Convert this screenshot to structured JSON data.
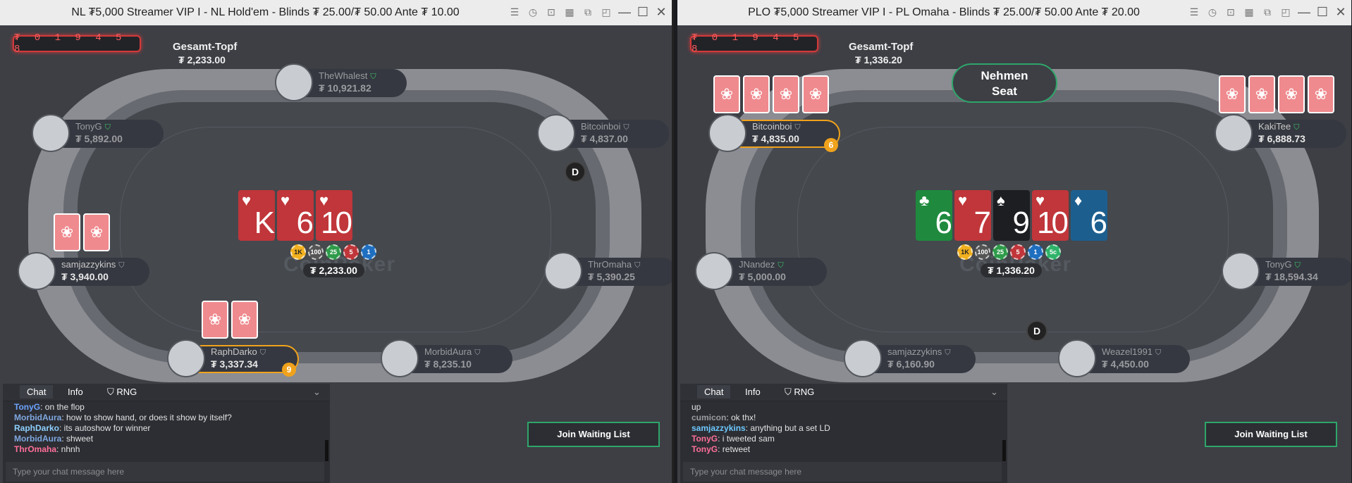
{
  "left": {
    "title": "NL ₮5,000 Streamer VIP I - NL Hold'em - Blinds ₮ 25.00/₮ 50.00 Ante ₮ 10.00",
    "ticker": "₮ 0 1 9  4 5 8",
    "pot_label": "Gesamt-Topf",
    "pot_total": "₮ 2,233.00",
    "center_pot": "₮ 2,233.00",
    "logo": "CoinPoker",
    "dealer": "D",
    "seats": [
      {
        "name": "TheWhalest",
        "stack": "₮ 10,921.82"
      },
      {
        "name": "TonyG",
        "stack": "₮ 5,892.00"
      },
      {
        "name": "Bitcoinboi",
        "stack": "₮ 4,837.00"
      },
      {
        "name": "samjazzykins",
        "stack": "₮ 3,940.00"
      },
      {
        "name": "ThrOmaha",
        "stack": "₮ 5,390.25"
      },
      {
        "name": "RaphDarko",
        "stack": "₮ 3,337.34",
        "seat_no": "9"
      },
      {
        "name": "MorbidAura",
        "stack": "₮ 8,235.10"
      }
    ],
    "board": [
      {
        "suit": "♥",
        "rank": "K",
        "color": "#c0363a"
      },
      {
        "suit": "♥",
        "rank": "6",
        "color": "#c0363a"
      },
      {
        "suit": "♥",
        "rank": "10",
        "color": "#c0363a"
      }
    ],
    "chips": [
      "1K",
      "100",
      "25",
      "5",
      "1"
    ],
    "chat": {
      "tabs": [
        "Chat",
        "Info",
        "RNG"
      ],
      "messages": [
        {
          "user": "TonyG",
          "text": ": on the flop",
          "color": "#6ea4ff"
        },
        {
          "user": "MorbidAura",
          "text": ": how to show hand, or does it show by itself?",
          "color": "#7fa7e0"
        },
        {
          "user": "RaphDarko",
          "text": ": its autoshow for winner",
          "color": "#8fd0ff"
        },
        {
          "user": "MorbidAura",
          "text": ": shweet",
          "color": "#7fa7e0"
        },
        {
          "user": "ThrOmaha",
          "text": ": nhnh",
          "color": "#ff6f9a"
        }
      ],
      "placeholder": "Type your chat message here"
    },
    "waitlist": "Join Waiting List"
  },
  "right": {
    "title": "PLO ₮5,000 Streamer VIP I - PL Omaha - Blinds ₮ 25.00/₮ 50.00 Ante ₮ 20.00",
    "ticker": "₮ 0 1 9  4 5 8",
    "pot_label": "Gesamt-Topf",
    "pot_total": "₮ 1,336.20",
    "center_pot": "₮ 1,336.20",
    "logo": "CoinPoker",
    "dealer": "D",
    "take_seat": [
      "Nehmen",
      "Seat"
    ],
    "seats": [
      {
        "name": "Bitcoinboi",
        "stack": "₮ 4,835.00",
        "seat_no": "6"
      },
      {
        "name": "KakiTee",
        "stack": "₮ 6,888.73"
      },
      {
        "name": "JNandez",
        "stack": "₮ 5,000.00"
      },
      {
        "name": "TonyG",
        "stack": "₮ 18,594.34"
      },
      {
        "name": "samjazzykins",
        "stack": "₮ 6,160.90"
      },
      {
        "name": "Weazel1991",
        "stack": "₮ 4,450.00"
      }
    ],
    "board": [
      {
        "suit": "♣",
        "rank": "6",
        "color": "#1f8a3e"
      },
      {
        "suit": "♥",
        "rank": "7",
        "color": "#c0363a"
      },
      {
        "suit": "♠",
        "rank": "9",
        "color": "#1d1e22"
      },
      {
        "suit": "♥",
        "rank": "10",
        "color": "#c0363a"
      },
      {
        "suit": "♦",
        "rank": "6",
        "color": "#1c5f8f"
      }
    ],
    "chips": [
      "1K",
      "100",
      "25",
      "5",
      "1",
      "5c"
    ],
    "chat": {
      "tabs": [
        "Chat",
        "Info",
        "RNG"
      ],
      "messages": [
        {
          "user": "",
          "text": "up",
          "color": "#e2e2e2"
        },
        {
          "user": "cumicon",
          "text": ": ok thx!",
          "color": "#9a9ca0"
        },
        {
          "user": "samjazzykins",
          "text": ": anything but a set LD",
          "color": "#6ec8ff"
        },
        {
          "user": "TonyG",
          "text": ": i tweeted sam",
          "color": "#ff6f9a"
        },
        {
          "user": "TonyG",
          "text": ": retweet",
          "color": "#ff6f9a"
        }
      ],
      "placeholder": "Type your chat message here"
    },
    "waitlist": "Join Waiting List"
  }
}
